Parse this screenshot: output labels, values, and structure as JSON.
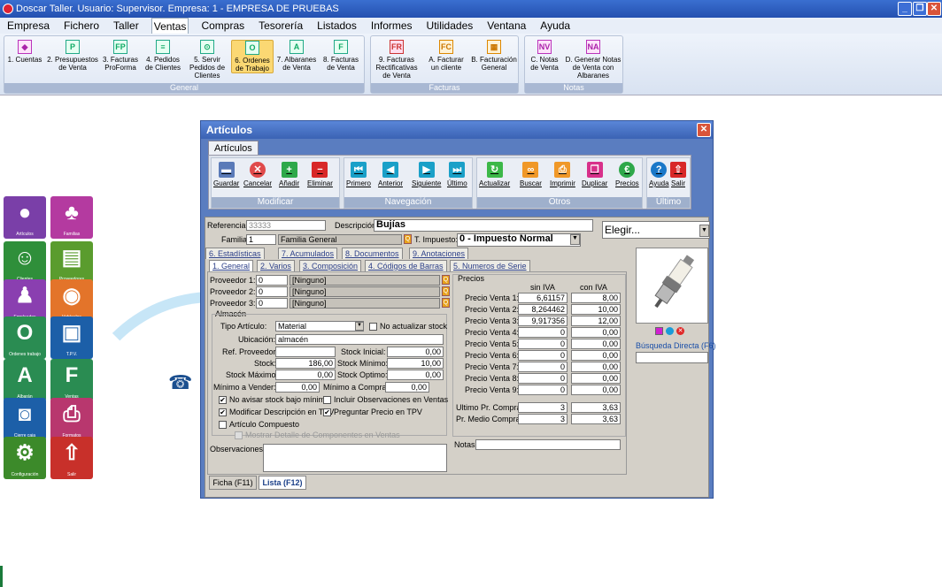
{
  "app": {
    "title": "Doscar Taller. Usuario: Supervisor. Empresa: 1 - EMPRESA DE PRUEBAS"
  },
  "menu": [
    "Empresa",
    "Fichero",
    "Taller",
    "Ventas",
    "Compras",
    "Tesorería",
    "Listados",
    "Informes",
    "Utilidades",
    "Ventana",
    "Ayuda"
  ],
  "ribbon": {
    "general_label": "General",
    "facturas_label": "Facturas",
    "notas_label": "Notas",
    "buttons": [
      "1. Cuentas",
      "2. Presupuestos de Venta",
      "3. Facturas ProForma",
      "4. Pedidos de Clientes",
      "5. Servir Pedidos de Clientes",
      "6. Ordenes de Trabajo",
      "7. Albaranes de Venta",
      "8. Facturas de Venta",
      "9. Facturas Rectificativas de Venta",
      "A. Facturar un cliente",
      "B. Facturación General",
      "C. Notas de Venta",
      "D. Generar Notas de Venta con Albaranes"
    ]
  },
  "tiles": [
    "Artículos",
    "Familias",
    "Clientes",
    "Proveedores",
    "Empleados",
    "Vehículos",
    "Ordenes trabajo",
    "T.P.V.",
    "Albarán",
    "Ventas",
    "Cierre caja",
    "Formatos",
    "Configuración",
    "Salir"
  ],
  "win": {
    "title": "Artículos",
    "tab": "Artículos",
    "groups": {
      "modificar": "Modificar",
      "navegacion": "Navegación",
      "otros": "Otros",
      "ultimo": "Último"
    },
    "tools": [
      "Guardar",
      "Cancelar",
      "Añadir",
      "Eliminar",
      "Primero",
      "Anterior",
      "Siguiente",
      "Último",
      "Actualizar",
      "Buscar",
      "Imprimir",
      "Duplicar",
      "Precios",
      "Ayuda",
      "Salir"
    ],
    "ref_label": "Referencia:",
    "ref": "33333",
    "desc_label": "Descripción:",
    "desc": "Bujías",
    "fam_label": "Familia:",
    "fam": "1",
    "fam_name": "Familia General",
    "imp_label": "T. Impuesto:",
    "imp": "0 - Impuesto Normal",
    "elegir": "Elegir...",
    "tabs1": [
      "6. Estadísticas",
      "7. Acumulados",
      "8. Documentos",
      "9. Anotaciones"
    ],
    "tabs2": [
      "1. General",
      "2. Varios",
      "3. Composición",
      "4. Códigos de Barras",
      "5. Numeros de Serie"
    ],
    "prov_labels": [
      "Proveedor 1:",
      "Proveedor 2:",
      "Proveedor 3:"
    ],
    "prov_vals": [
      "0",
      "0",
      "0"
    ],
    "ninguno": "[Ninguno]",
    "almacen": "Almacén",
    "tipo_label": "Tipo Artículo:",
    "tipo": "Material",
    "no_act": "No actualizar stock",
    "ubic_label": "Ubicación:",
    "ubic": "almacén",
    "refprov_label": "Ref. Proveedor:",
    "stock_ini_label": "Stock Inicial:",
    "stock_ini": "0,00",
    "stock_label": "Stock:",
    "stock": "186,00",
    "stock_min_label": "Stock Mínimo:",
    "stock_min": "10,00",
    "stock_max_label": "Stock Máximo:",
    "stock_max": "0,00",
    "stock_opt_label": "Stock Optimo:",
    "stock_opt": "0,00",
    "min_vender_label": "Mínimo a Vender:",
    "min_vender": "0,00",
    "min_comprar_label": "Mínimo a Comprar:",
    "min_comprar": "0,00",
    "chk_no_avisar": "No avisar stock bajo mínimo",
    "chk_incluir": "Incluir Observaciones en Ventas",
    "chk_mod_desc": "Modificar Descripción en TPV",
    "chk_preg_precio": "Preguntar Precio en TPV",
    "chk_compuesto": "Artículo Compuesto",
    "chk_mostrar": "Mostrar Detalle de Componentes en Ventas",
    "obs_label": "Observaciones:",
    "precios": "Precios",
    "sin_iva": "sin IVA",
    "con_iva": "con IVA",
    "pv_labels": [
      "Precio Venta 1:",
      "Precio Venta 2:",
      "Precio Venta 3:",
      "Precio Venta 4:",
      "Precio Venta 5:",
      "Precio Venta 6:",
      "Precio Venta 7:",
      "Precio Venta 8:",
      "Precio Venta 9:"
    ],
    "pv_sin": [
      "6,61157",
      "8,264462",
      "9,917356",
      "0",
      "0",
      "0",
      "0",
      "0",
      "0"
    ],
    "pv_con": [
      "8,00",
      "10,00",
      "12,00",
      "0,00",
      "0,00",
      "0,00",
      "0,00",
      "0,00",
      "0,00"
    ],
    "ult_label": "Ultimo Pr. Compra:",
    "ult_sin": "3",
    "ult_con": "3,63",
    "med_label": "Pr. Medio Compra:",
    "med_sin": "3",
    "med_con": "3,63",
    "notas_label": "Notas:",
    "busq": "Búsqueda Directa (F6)",
    "bottom_tabs": [
      "Ficha (F11)",
      "Lista (F12)"
    ]
  }
}
